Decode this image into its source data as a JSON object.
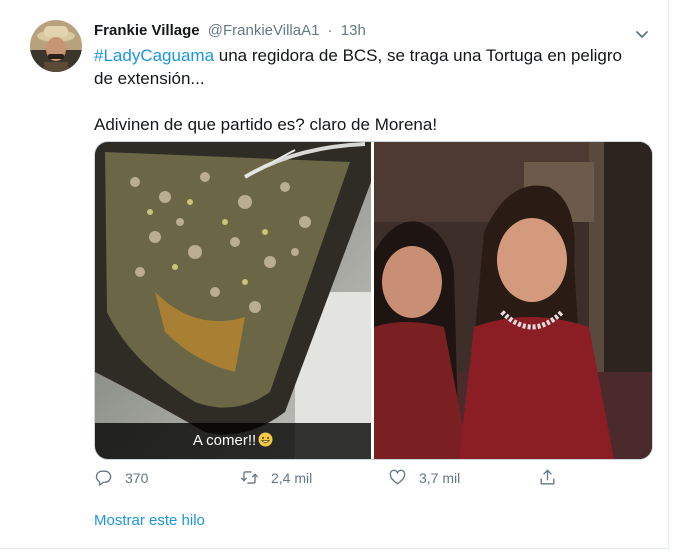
{
  "tweet": {
    "author_name": "Frankie Village",
    "author_handle": "@FrankieVillaA1",
    "separator": "·",
    "time": "13h",
    "hashtag": "#LadyCaguama",
    "text_line1": " una regidora de BCS, se traga una Tortuga en peligro de extensión...",
    "text_line2": "Adivinen de que partido es? claro de Morena!",
    "media": {
      "left_caption": "A comer!!"
    },
    "actions": {
      "replies": "370",
      "retweets": "2,4 mil",
      "likes": "3,7 mil"
    },
    "show_thread": "Mostrar este hilo"
  },
  "icons": {
    "reply": "reply-bubble-icon",
    "retweet": "retweet-icon",
    "like": "heart-icon",
    "share": "share-upload-icon",
    "caret": "chevron-down-icon"
  },
  "colors": {
    "link": "#1b95e0",
    "muted": "#657786",
    "text": "#14171a"
  }
}
